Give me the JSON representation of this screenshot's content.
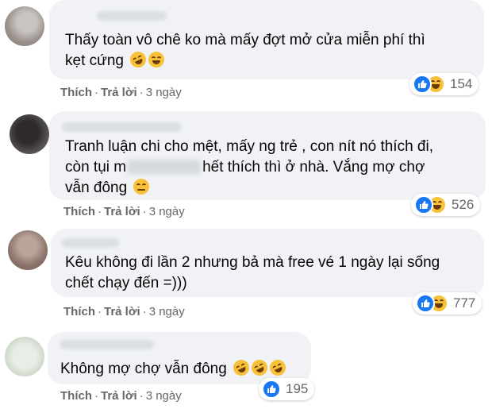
{
  "comments": [
    {
      "text_lines": [
        "Thấy toàn vô chê ko mà mấy đợt mở cửa miễn phí thì",
        "kẹt cứng"
      ],
      "emoji": [
        "rolling-laughing-emoji",
        "grinning-emoji"
      ],
      "actions": {
        "like": "Thích",
        "reply": "Trả lời",
        "time": "3 ngày"
      },
      "reactions": {
        "types": [
          "like",
          "haha"
        ],
        "count": "154"
      }
    },
    {
      "text_lines": [
        "Tranh luận chi cho mệt, mấy ng trẻ , con nít nó thích đi,",
        "còn tụi m",
        "hết thích thì ở nhà. Vắng mợ chợ",
        "vẫn đông"
      ],
      "emoji": [
        "relieved-emoji"
      ],
      "actions": {
        "like": "Thích",
        "reply": "Trả lời",
        "time": "3 ngày"
      },
      "reactions": {
        "types": [
          "like",
          "haha"
        ],
        "count": "526"
      }
    },
    {
      "text_lines": [
        "Kêu không đi lần 2 nhưng bả mà free vé 1 ngày lại sống",
        "chết chạy đến =)))"
      ],
      "emoji": [],
      "actions": {
        "like": "Thích",
        "reply": "Trả lời",
        "time": "3 ngày"
      },
      "reactions": {
        "types": [
          "like",
          "haha"
        ],
        "count": "777"
      }
    },
    {
      "text_lines": [
        "Không mợ chợ vẫn đông"
      ],
      "emoji": [
        "rolling-laughing-emoji",
        "rolling-laughing-emoji",
        "rolling-laughing-emoji"
      ],
      "actions": {
        "like": "Thích",
        "reply": "Trả lời",
        "time": "3 ngày"
      },
      "reactions": {
        "types": [
          "like"
        ],
        "count": "195"
      }
    }
  ],
  "colors": {
    "bubble": "#f0f2f5",
    "meta": "#65676b",
    "like": "#1877f2",
    "haha": "#f7c139"
  }
}
